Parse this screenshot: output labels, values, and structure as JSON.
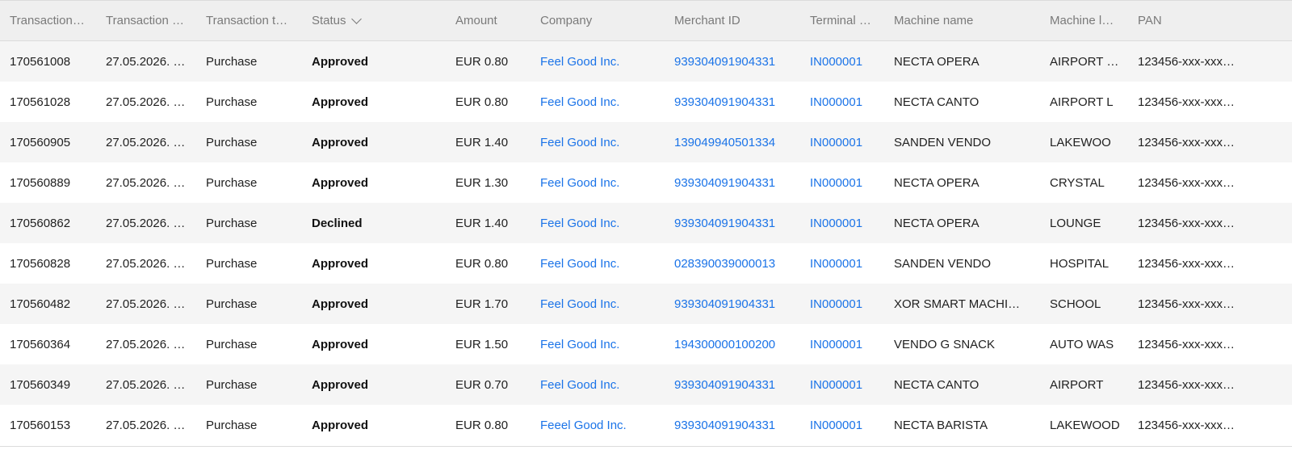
{
  "columns": [
    {
      "label": "Transaction…"
    },
    {
      "label": "Transaction …"
    },
    {
      "label": "Transaction t…"
    },
    {
      "label": "Status",
      "sort_icon": "chevron-down-icon"
    },
    {
      "label": "Amount"
    },
    {
      "label": "Company"
    },
    {
      "label": "Merchant ID"
    },
    {
      "label": "Terminal …"
    },
    {
      "label": "Machine name"
    },
    {
      "label": "Machine l…"
    },
    {
      "label": "PAN"
    }
  ],
  "colors": {
    "link": "#1a73e8",
    "header_bg": "#efefef",
    "stripe_bg": "#f5f5f5"
  },
  "rows": [
    {
      "id": "170561008",
      "date": "27.05.2026. …",
      "type": "Purchase",
      "status": "Approved",
      "amount": "EUR 0.80",
      "company": "Feel Good Inc.",
      "merchant_id": "939304091904331",
      "terminal": "IN000001",
      "machine_name": "NECTA OPERA",
      "machine_loc": "AIRPORT L…",
      "pan": "123456-xxx-xxx…"
    },
    {
      "id": "170561028",
      "date": "27.05.2026. …",
      "type": "Purchase",
      "status": "Approved",
      "amount": "EUR 0.80",
      "company": "Feel Good Inc.",
      "merchant_id": "939304091904331",
      "terminal": "IN000001",
      "machine_name": "NECTA CANTO",
      "machine_loc": "AIRPORT L",
      "pan": "123456-xxx-xxx…"
    },
    {
      "id": "170560905",
      "date": "27.05.2026. …",
      "type": "Purchase",
      "status": "Approved",
      "amount": "EUR 1.40",
      "company": "Feel Good Inc.",
      "merchant_id": "139049940501334",
      "terminal": "IN000001",
      "machine_name": "SANDEN VENDO",
      "machine_loc": "LAKEWOO",
      "pan": "123456-xxx-xxx…"
    },
    {
      "id": "170560889",
      "date": "27.05.2026. …",
      "type": "Purchase",
      "status": "Approved",
      "amount": "EUR 1.30",
      "company": "Feel Good Inc.",
      "merchant_id": "939304091904331",
      "terminal": "IN000001",
      "machine_name": "NECTA OPERA",
      "machine_loc": "CRYSTAL",
      "pan": "123456-xxx-xxx…"
    },
    {
      "id": "170560862",
      "date": "27.05.2026. …",
      "type": "Purchase",
      "status": "Declined",
      "amount": "EUR 1.40",
      "company": "Feel Good Inc.",
      "merchant_id": "939304091904331",
      "terminal": "IN000001",
      "machine_name": "NECTA OPERA",
      "machine_loc": "LOUNGE",
      "pan": "123456-xxx-xxx…"
    },
    {
      "id": "170560828",
      "date": "27.05.2026. …",
      "type": "Purchase",
      "status": "Approved",
      "amount": "EUR 0.80",
      "company": "Feel Good Inc.",
      "merchant_id": "028390039000013",
      "terminal": "IN000001",
      "machine_name": "SANDEN VENDO",
      "machine_loc": "HOSPITAL",
      "pan": "123456-xxx-xxx…"
    },
    {
      "id": "170560482",
      "date": "27.05.2026. …",
      "type": "Purchase",
      "status": "Approved",
      "amount": "EUR 1.70",
      "company": "Feel Good Inc.",
      "merchant_id": "939304091904331",
      "terminal": "IN000001",
      "machine_name": "XOR SMART MACHI…",
      "machine_loc": "SCHOOL",
      "pan": "123456-xxx-xxx…"
    },
    {
      "id": "170560364",
      "date": "27.05.2026. …",
      "type": "Purchase",
      "status": "Approved",
      "amount": "EUR 1.50",
      "company": "Feel Good Inc.",
      "merchant_id": "194300000100200",
      "terminal": "IN000001",
      "machine_name": "VENDO G SNACK",
      "machine_loc": "AUTO WAS",
      "pan": "123456-xxx-xxx…"
    },
    {
      "id": "170560349",
      "date": "27.05.2026. …",
      "type": "Purchase",
      "status": "Approved",
      "amount": "EUR 0.70",
      "company": "Feel Good Inc.",
      "merchant_id": "939304091904331",
      "terminal": "IN000001",
      "machine_name": "NECTA CANTO",
      "machine_loc": "AIRPORT",
      "pan": "123456-xxx-xxx…"
    },
    {
      "id": "170560153",
      "date": "27.05.2026. …",
      "type": "Purchase",
      "status": "Approved",
      "amount": "EUR 0.80",
      "company": "Feeel Good Inc.",
      "merchant_id": "939304091904331",
      "terminal": "IN000001",
      "machine_name": "NECTA BARISTA",
      "machine_loc": "LAKEWOOD",
      "pan": "123456-xxx-xxx…"
    }
  ]
}
